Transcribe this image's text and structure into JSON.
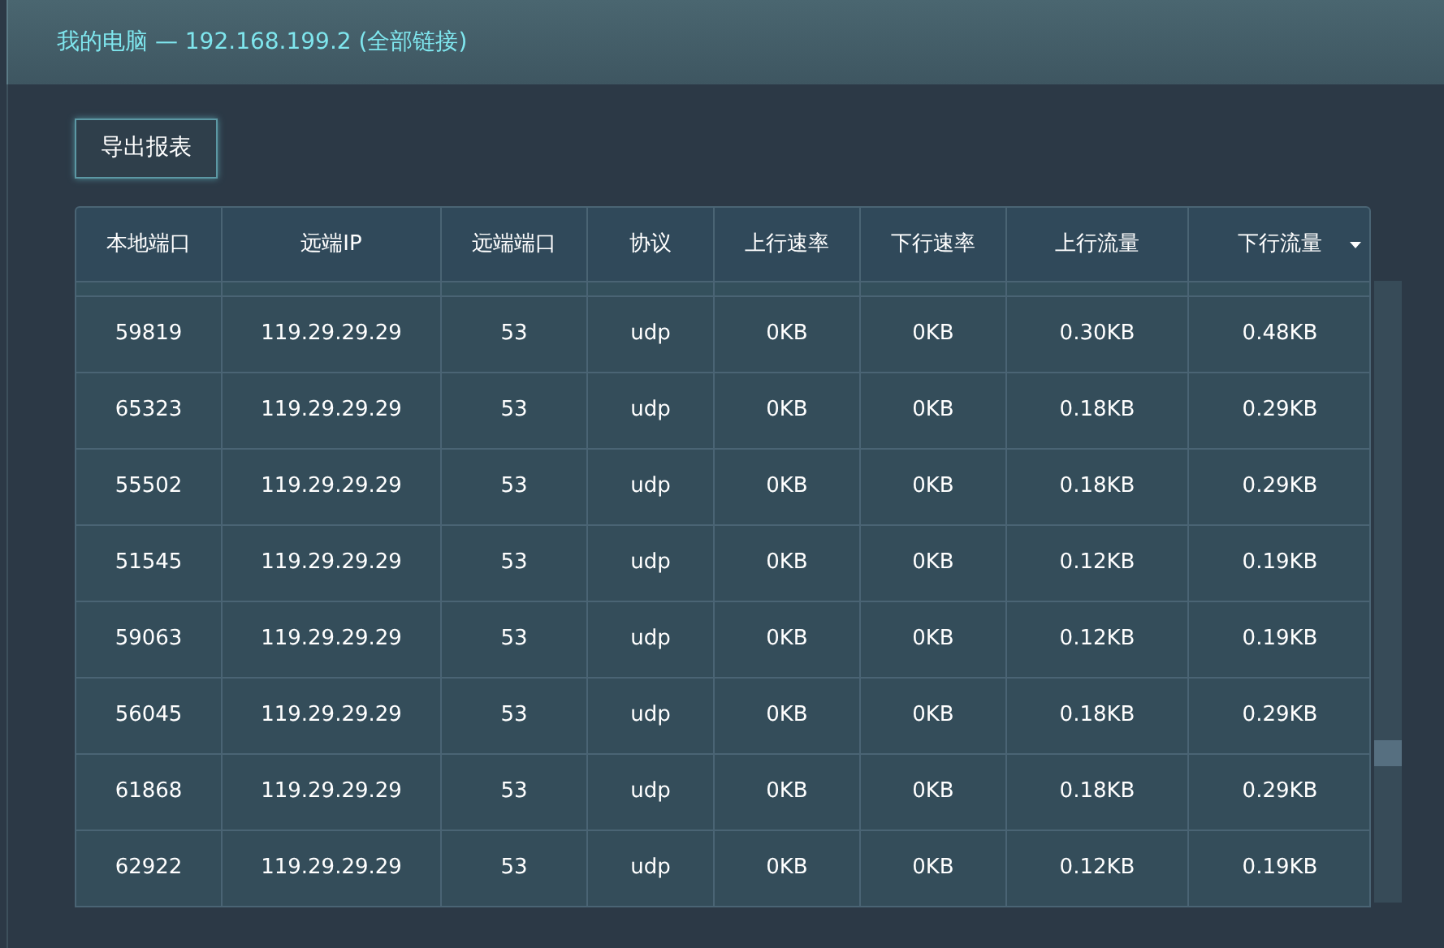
{
  "window": {
    "title": "我的电脑 — 192.168.199.2 (全部链接)"
  },
  "export_button": "导出报表",
  "table": {
    "columns": [
      {
        "label": "本地端口",
        "sorted": false
      },
      {
        "label": "远端IP",
        "sorted": false
      },
      {
        "label": "远端端口",
        "sorted": false
      },
      {
        "label": "协议",
        "sorted": false
      },
      {
        "label": "上行速率",
        "sorted": false
      },
      {
        "label": "下行速率",
        "sorted": false
      },
      {
        "label": "上行流量",
        "sorted": false
      },
      {
        "label": "下行流量",
        "sorted": true
      }
    ],
    "rows": [
      [
        "59819",
        "119.29.29.29",
        "53",
        "udp",
        "0KB",
        "0KB",
        "0.30KB",
        "0.48KB"
      ],
      [
        "65323",
        "119.29.29.29",
        "53",
        "udp",
        "0KB",
        "0KB",
        "0.18KB",
        "0.29KB"
      ],
      [
        "55502",
        "119.29.29.29",
        "53",
        "udp",
        "0KB",
        "0KB",
        "0.18KB",
        "0.29KB"
      ],
      [
        "51545",
        "119.29.29.29",
        "53",
        "udp",
        "0KB",
        "0KB",
        "0.12KB",
        "0.19KB"
      ],
      [
        "59063",
        "119.29.29.29",
        "53",
        "udp",
        "0KB",
        "0KB",
        "0.12KB",
        "0.19KB"
      ],
      [
        "56045",
        "119.29.29.29",
        "53",
        "udp",
        "0KB",
        "0KB",
        "0.18KB",
        "0.29KB"
      ],
      [
        "61868",
        "119.29.29.29",
        "53",
        "udp",
        "0KB",
        "0KB",
        "0.18KB",
        "0.29KB"
      ],
      [
        "62922",
        "119.29.29.29",
        "53",
        "udp",
        "0KB",
        "0KB",
        "0.12KB",
        "0.19KB"
      ]
    ]
  }
}
